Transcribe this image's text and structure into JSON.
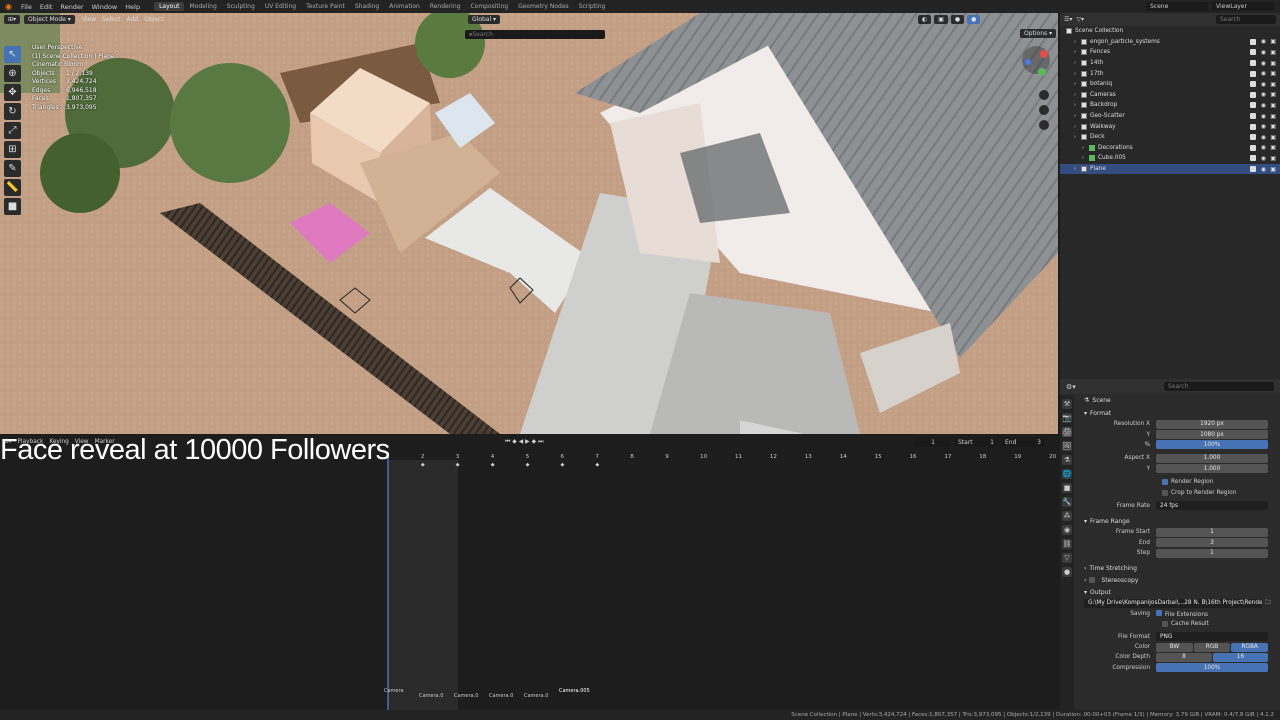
{
  "menu": [
    "File",
    "Edit",
    "Render",
    "Window",
    "Help"
  ],
  "workspaces": [
    "Layout",
    "Modeling",
    "Sculpting",
    "UV Editing",
    "Texture Paint",
    "Shading",
    "Animation",
    "Rendering",
    "Compositing",
    "Geometry Nodes",
    "Scripting"
  ],
  "active_workspace": "Layout",
  "scene_field": "Scene",
  "viewlayer_field": "ViewLayer",
  "viewport": {
    "mode": "Object Mode",
    "menus": [
      "View",
      "Select",
      "Add",
      "Object"
    ],
    "orientation": "Global",
    "search_placeholder": "Search",
    "options_label": "Options",
    "info": {
      "title": "User Perspective",
      "collection": "(1) Scene Collection | Plane",
      "extra": "Cinematic Bloom",
      "rows": [
        {
          "k": "Objects",
          "v": "1 / 2,139"
        },
        {
          "k": "Vertices",
          "v": "3,424,724"
        },
        {
          "k": "Edges",
          "v": "6,946,518"
        },
        {
          "k": "Faces",
          "v": "1,807,357"
        },
        {
          "k": "Triangles",
          "v": "3,973,095"
        }
      ]
    }
  },
  "outliner": {
    "search_placeholder": "Search",
    "root": "Scene Collection",
    "items": [
      {
        "label": "engon_particle_systems",
        "indent": 1
      },
      {
        "label": "Fences",
        "indent": 1
      },
      {
        "label": "14th",
        "indent": 1
      },
      {
        "label": "17th",
        "indent": 1
      },
      {
        "label": "botaniq",
        "indent": 1
      },
      {
        "label": "Cameras",
        "indent": 1
      },
      {
        "label": "Backdrop",
        "indent": 1
      },
      {
        "label": "Geo-Scatter",
        "indent": 1
      },
      {
        "label": "Walkway",
        "indent": 1
      },
      {
        "label": "Deck",
        "indent": 1
      },
      {
        "label": "Decorations",
        "indent": 2
      },
      {
        "label": "Cube.005",
        "indent": 2
      },
      {
        "label": "Plane",
        "indent": 1,
        "selected": true
      }
    ]
  },
  "properties": {
    "search_placeholder": "Search",
    "context": "Scene",
    "format_label": "Format",
    "resolution_x_label": "Resolution X",
    "resolution_x": "1920 px",
    "y_label": "Y",
    "resolution_y": "1080 px",
    "pct_label": "%",
    "resolution_pct": "100%",
    "aspect_x_label": "Aspect X",
    "aspect_x": "1.000",
    "aspect_y": "1.000",
    "render_region": "Render Region",
    "crop_region": "Crop to Render Region",
    "frame_rate_label": "Frame Rate",
    "frame_rate": "24 fps",
    "frame_range_label": "Frame Range",
    "frame_start_label": "Frame Start",
    "frame_start": "1",
    "end_label": "End",
    "frame_end": "3",
    "step_label": "Step",
    "frame_step": "1",
    "time_stretching": "Time Stretching",
    "stereoscopy": "Stereoscopy",
    "output_label": "Output",
    "output_path": "G:\\My Drive\\KompanijosDarbai\\...28 N. B\\16th Project\\Renders2\\",
    "saving_label": "Saving",
    "file_extensions": "File Extensions",
    "cache_result": "Cache Result",
    "file_format_label": "File Format",
    "file_format": "PNG",
    "color_label": "Color",
    "color_opts": [
      "BW",
      "RGB",
      "RGBA"
    ],
    "color_active": "RGBA",
    "color_depth_label": "Color Depth",
    "color_depth": [
      "8",
      "16"
    ],
    "compression_label": "Compression",
    "compression": "100%"
  },
  "timeline": {
    "menus": [
      "Playback",
      "Keying",
      "View",
      "Marker"
    ],
    "current_frame": "1",
    "start_label": "Start",
    "start": "1",
    "end_label": "End",
    "end": "3",
    "ticks": [
      "1",
      "2",
      "3",
      "4",
      "5",
      "6",
      "7",
      "8",
      "9",
      "10",
      "11",
      "12",
      "13",
      "14",
      "15",
      "16",
      "17",
      "18",
      "19",
      "20"
    ],
    "markers": [
      "Camera",
      "Camera.0",
      "Camera.0",
      "Camera.0",
      "Camera.0",
      "Camera.005"
    ]
  },
  "overlay_caption": "Face reveal at 10000 Followers",
  "statusbar": "Scene Collection | Plane | Verts:3,424,724 | Faces:1,807,357 | Tris:3,973,095 | Objects:1/2,139 | Duration: 00:00+03 (Frame 1/3) | Memory: 3.79 GiB | VRAM: 0.4/7.8 GiB | 4.1.2",
  "colors": {
    "accent": "#4772b3",
    "selection": "#334d80",
    "bg": "#1d1d1d"
  }
}
